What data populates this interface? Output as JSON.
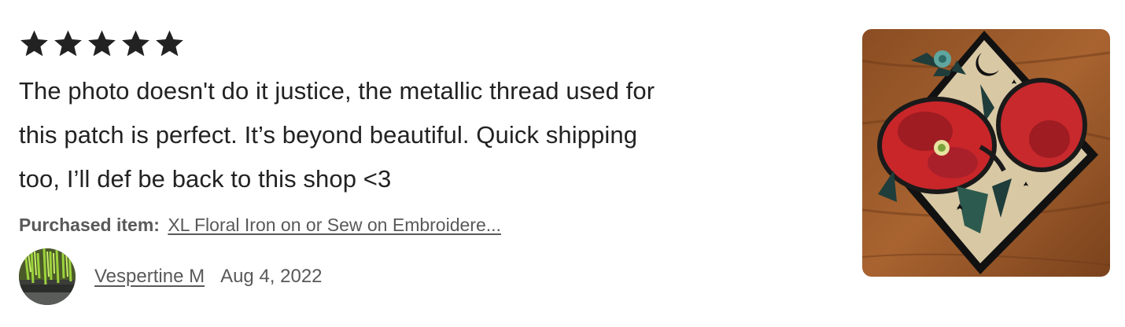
{
  "review": {
    "rating": 5,
    "rating_max": 5,
    "star_icon": "star-icon",
    "star_color": "#222222",
    "text_line_1": "The photo doesn't do it justice, the metallic thread used for",
    "text_line_2": "this patch is perfect. It’s beyond beautiful. Quick shipping",
    "text_line_3": "too, I’ll def be back to this shop <3",
    "purchased_label": "Purchased item:",
    "purchased_item": "XL Floral Iron on or Sew on Embroidere...",
    "reviewer_name": "Vespertine M",
    "date": "Aug 4, 2022",
    "avatar_icon": "reviewer-avatar",
    "photo_icon": "review-photo"
  }
}
